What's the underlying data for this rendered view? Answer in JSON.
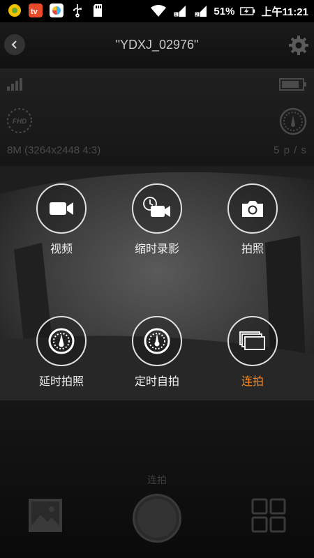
{
  "status_bar": {
    "battery_percent": "51%",
    "time": "上午11:21"
  },
  "header": {
    "title": "\"YDXJ_02976\""
  },
  "info": {
    "video_quality_badge": "FHD",
    "resolution": "8M (3264x2448 4:3)",
    "burst_rate": "5 p / s"
  },
  "modes": [
    {
      "label": "视频",
      "icon": "video-camera-icon",
      "active": false
    },
    {
      "label": "缩时录影",
      "icon": "timelapse-video-icon",
      "active": false
    },
    {
      "label": "拍照",
      "icon": "camera-icon",
      "active": false
    },
    {
      "label": "延时拍照",
      "icon": "timelapse-photo-icon",
      "active": false
    },
    {
      "label": "定时自拍",
      "icon": "self-timer-icon",
      "active": false
    },
    {
      "label": "连拍",
      "icon": "burst-icon",
      "active": true
    }
  ],
  "bottom": {
    "current_mode": "连拍"
  },
  "colors": {
    "accent": "#ff8a1c",
    "background": "#0b0b0b"
  }
}
